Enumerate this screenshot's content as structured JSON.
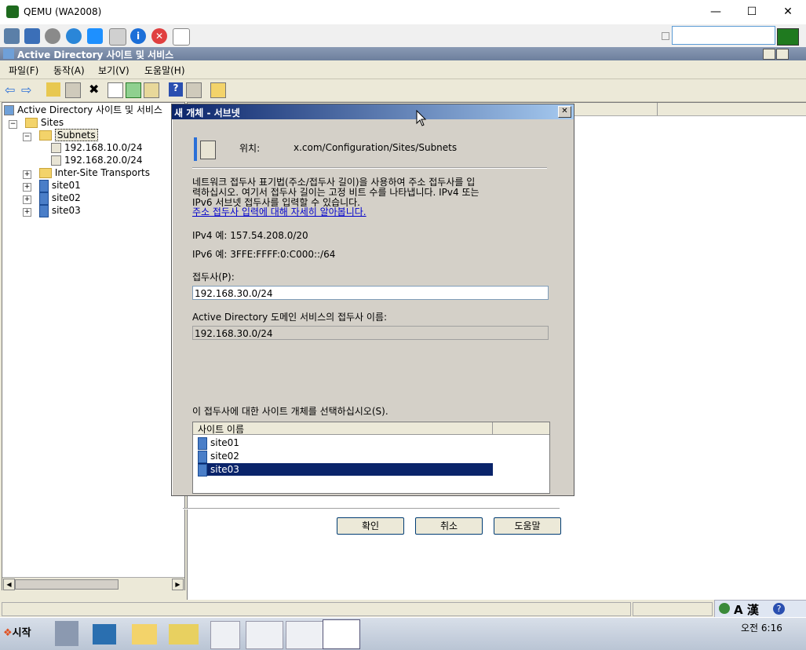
{
  "window": {
    "title": "QEMU (WA2008)",
    "controls": {
      "minimize": "—",
      "maximize": "☐",
      "close": "✕"
    }
  },
  "mmc": {
    "title": "Active Directory 사이트 및 서비스",
    "menu": [
      "파일(F)",
      "동작(A)",
      "보기(V)",
      "도움말(H)"
    ]
  },
  "tree": {
    "root": "Active Directory 사이트 및 서비스",
    "sites": "Sites",
    "subnets": "Subnets",
    "subnet_items": [
      "192.168.10.0/24",
      "192.168.20.0/24"
    ],
    "transports": "Inter-Site Transports",
    "site_items": [
      "site01",
      "site02",
      "site03"
    ]
  },
  "dialog": {
    "title": "새 개체 - 서브넷",
    "close": "✕",
    "location_label": "위치:",
    "location_value": "x.com/Configuration/Sites/Subnets",
    "desc_line1": "네트워크 접두사 표기법(주소/접두사 길이)을 사용하여 주소 접두사를 입",
    "desc_line2": "력하십시오. 여기서 접두사 길이는 고정 비트 수를 나타냅니다. IPv4 또는",
    "desc_line3": "IPv6 서브넷 접두사를 입력할 수 있습니다.",
    "learn_more_link": "주소 접두사 입력에 대해 자세히 알아봅니다.",
    "ipv4_example": "IPv4 예: 157.54.208.0/20",
    "ipv6_example": "IPv6 예: 3FFE:FFFF:0:C000::/64",
    "prefix_label": "접두사(P):",
    "prefix_value": "192.168.30.0/24",
    "ad_prefix_label": "Active Directory 도메인 서비스의 접두사 이름:",
    "ad_prefix_value": "192.168.30.0/24",
    "select_site_label": "이 접두사에 대한 사이트 개체를 선택하십시오(S).",
    "list_header": "사이트 이름",
    "sites": [
      "site01",
      "site02",
      "site03"
    ],
    "selected_site": "site03",
    "ok": "확인",
    "cancel": "취소",
    "help": "도움말"
  },
  "taskbar": {
    "start": "시작",
    "clock": "오전 6:16",
    "ime": "A 漢"
  },
  "colors": {
    "dialog_title_start": "#0a246a",
    "dialog_title_end": "#a6caf0",
    "selection": "#0a246a",
    "link": "#0000cc"
  }
}
